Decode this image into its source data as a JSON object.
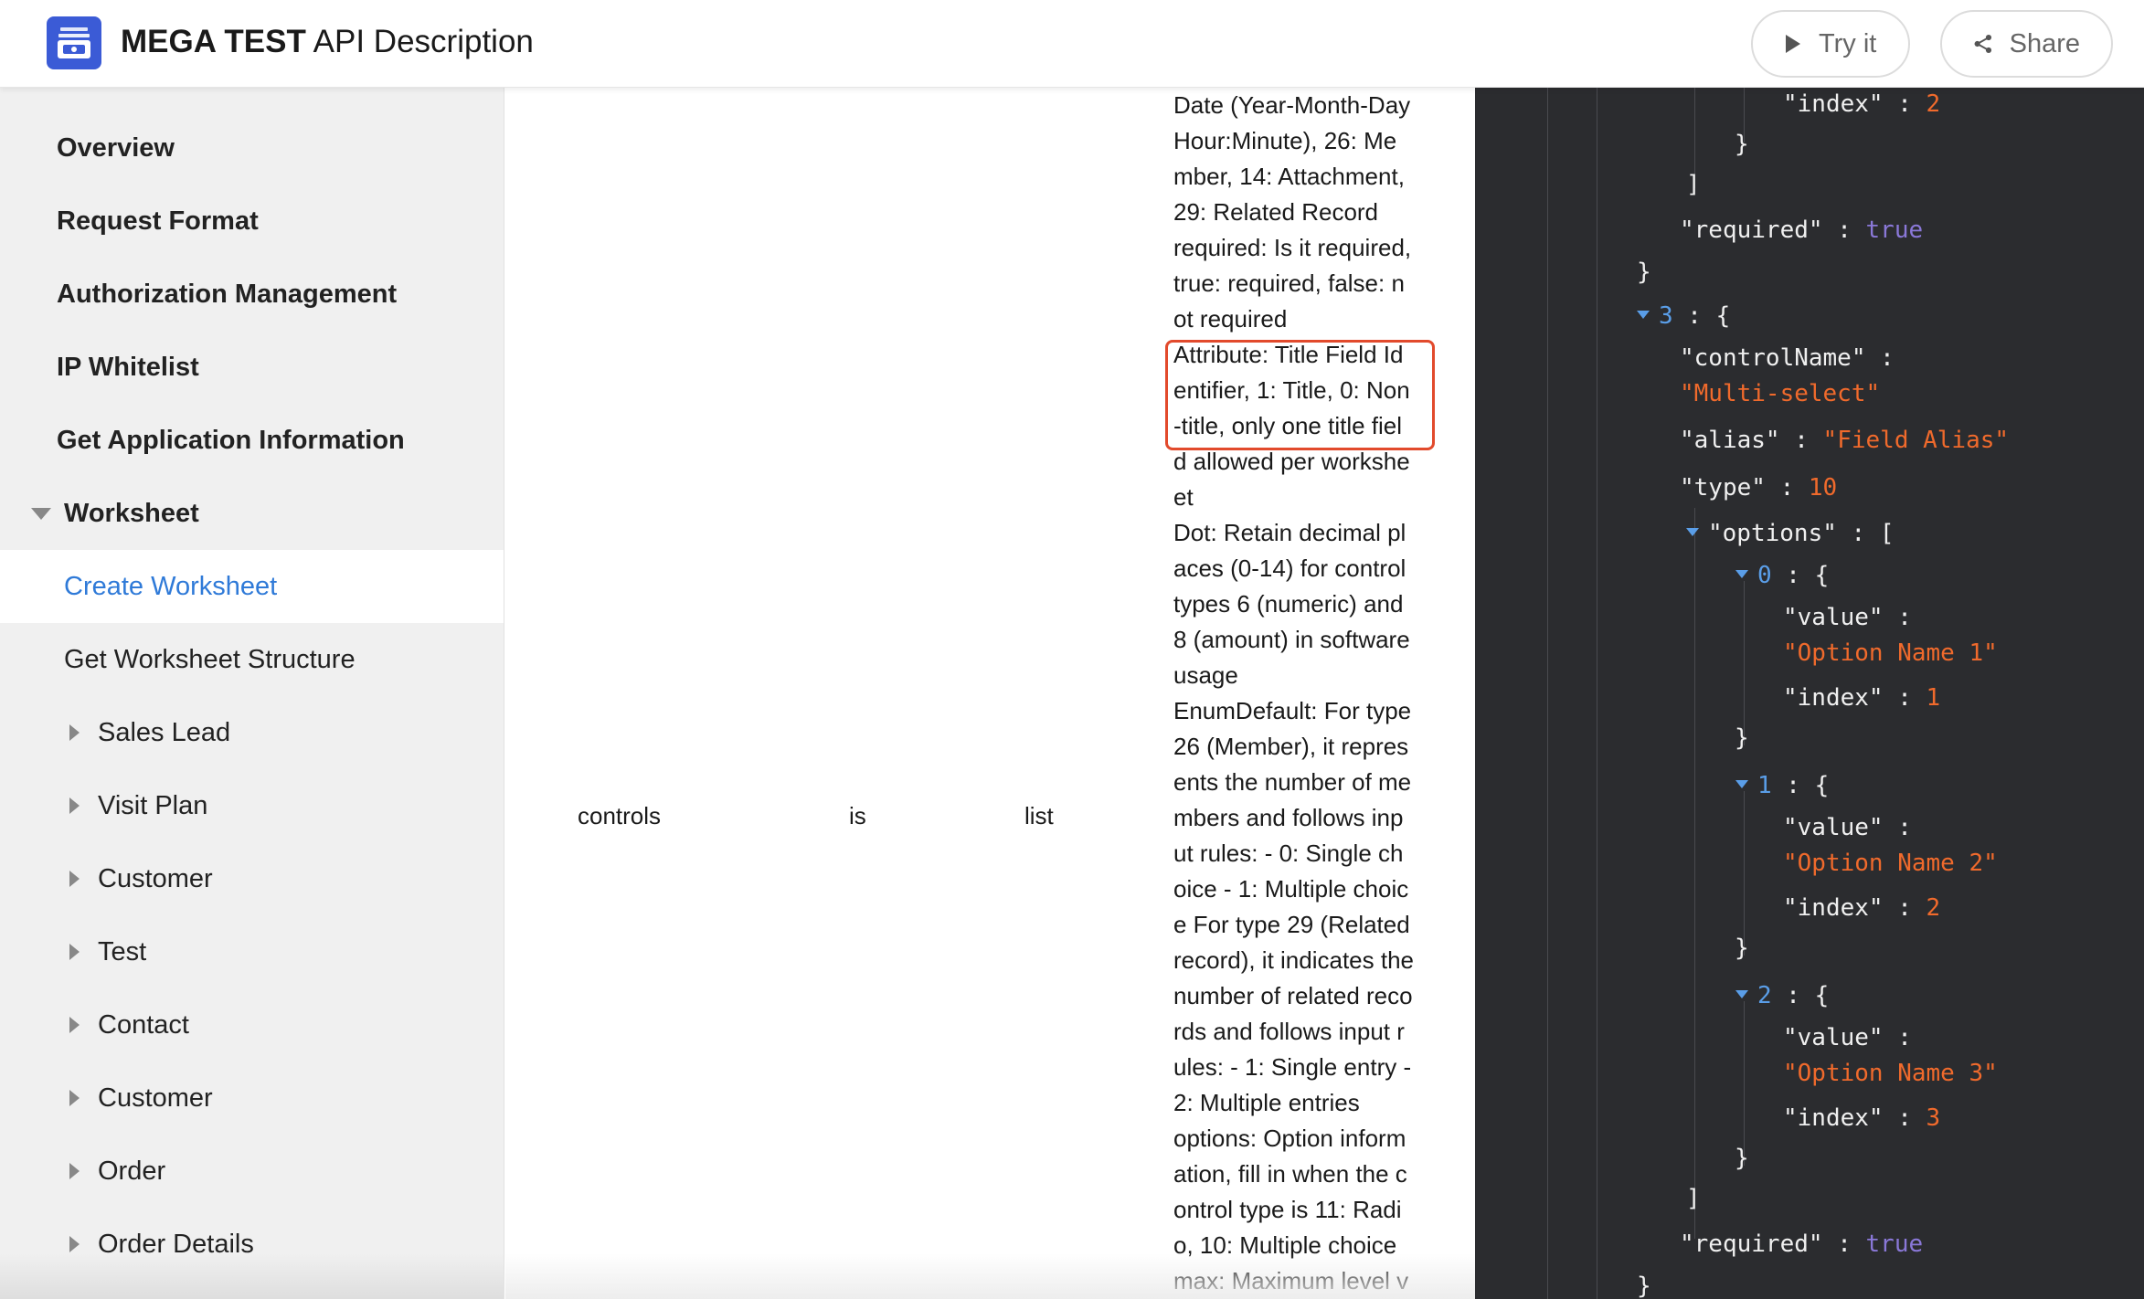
{
  "header": {
    "title_bold": "MEGA TEST",
    "title_rest": " API Description",
    "try_label": "Try it",
    "share_label": "Share"
  },
  "sidebar": {
    "top_items": [
      "Overview",
      "Request Format",
      "Authorization Management",
      "IP Whitelist",
      "Get Application Information"
    ],
    "group_label": "Worksheet",
    "active_item": "Create Worksheet",
    "sub_item": "Get Worksheet Structure",
    "folders": [
      "Sales Lead",
      "Visit Plan",
      "Customer",
      "Test",
      "Contact",
      "Customer",
      "Order",
      "Order Details"
    ]
  },
  "table_row": {
    "name": "controls",
    "required": "is",
    "type": "list",
    "description_lines": [
      "Date (Year-Month-Day",
      "Hour:Minute), 26: Me",
      "mber, 14: Attachment,",
      "29: Related Record",
      "required: Is it required,",
      "true: required, false: n",
      "ot required",
      "Attribute: Title Field Id",
      "entifier, 1: Title, 0: Non",
      "-title, only one title fiel",
      "d allowed per workshe",
      "et",
      "Dot: Retain decimal pl",
      "aces (0-14) for control",
      "types 6 (numeric) and",
      "8 (amount) in software",
      "usage",
      "EnumDefault: For type",
      "26 (Member), it repres",
      "ents the number of me",
      "mbers and follows inp",
      "ut rules: - 0: Single ch",
      "oice - 1: Multiple choic",
      "e For type 29 (Related",
      "record), it indicates the",
      "number of related reco",
      "rds and follows input r",
      "ules: - 1: Single entry -",
      "2: Multiple entries",
      "options: Option inform",
      "ation, fill in when the c",
      "ontrol type is 11: Radi",
      "o, 10: Multiple choice",
      "max: Maximum level v"
    ]
  },
  "code": {
    "index_key": "\"index\"",
    "index_val_top": "2",
    "required_key": "\"required\"",
    "true_val": "true",
    "item_index": "3",
    "control_name_key": "\"controlName\"",
    "control_name_val": "\"Multi-select\"",
    "alias_key": "\"alias\"",
    "alias_val": "\"Field Alias\"",
    "type_key": "\"type\"",
    "type_val": "10",
    "options_key": "\"options\"",
    "value_key": "\"value\"",
    "options": [
      {
        "idx": "0",
        "value": "\"Option Name 1\"",
        "index": "1"
      },
      {
        "idx": "1",
        "value": "\"Option Name 2\"",
        "index": "2"
      },
      {
        "idx": "2",
        "value": "\"Option Name 3\"",
        "index": "3"
      }
    ]
  }
}
